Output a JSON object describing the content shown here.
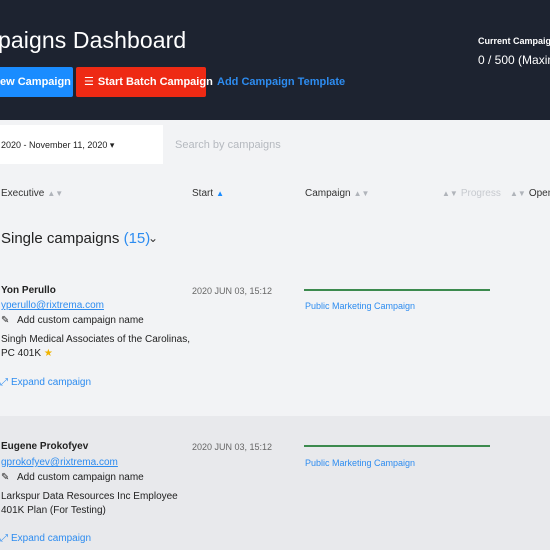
{
  "header": {
    "title": "paigns Dashboard",
    "new_campaign_label": "ew Campaign",
    "batch_campaign_label": "Start Batch Campaign",
    "template_label": "Add Campaign Template",
    "current_campaigns_label": "Current Campaig",
    "current_campaigns_value": "0 / 500 (Maxim"
  },
  "filters": {
    "date_range": "2020 - November 11, 2020",
    "search_placeholder": "Search by campaigns"
  },
  "columns": {
    "executive": "Executive",
    "start": "Start",
    "campaign": "Campaign",
    "progress": "Progress",
    "opened": "Opene"
  },
  "group": {
    "title": "Single campaigns",
    "count": "(15)"
  },
  "rows": [
    {
      "name": "Yon Perullo",
      "email": "yperullo@rixtrema.com",
      "add_custom": "Add custom campaign name",
      "company": "Singh Medical Associates of the Carolinas, PC 401K",
      "expand": "Expand campaign",
      "start": "2020 JUN 03, 15:12",
      "campaign": "Public Marketing Campaign"
    },
    {
      "name": "Eugene Prokofyev",
      "email": "gprokofyev@rixtrema.com",
      "add_custom": "Add custom campaign name",
      "company": "Larkspur Data Resources Inc Employee 401K Plan (For Testing)",
      "expand": "Expand campaign",
      "start": "2020 JUN 03, 15:12",
      "campaign": "Public Marketing Campaign"
    }
  ],
  "colors": {
    "header_bg": "#1d2330",
    "primary_blue": "#1a8cff",
    "danger_red": "#ee2a14",
    "progress_green": "#3c8a4e",
    "link_blue": "#2d8cf0"
  }
}
